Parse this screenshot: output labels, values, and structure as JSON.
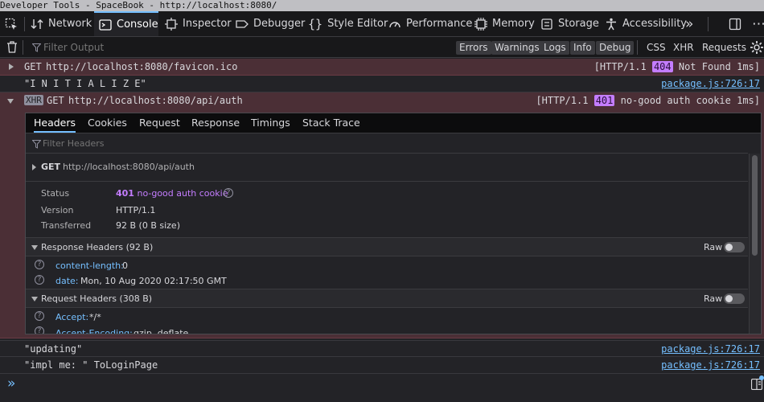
{
  "window": {
    "title": "Developer Tools - SpaceBook - http://localhost:8080/"
  },
  "tabs": [
    {
      "label": "Network",
      "icon": "network-icon"
    },
    {
      "label": "Console",
      "icon": "console-icon",
      "selected": true
    },
    {
      "label": "Inspector",
      "icon": "inspector-icon"
    },
    {
      "label": "Debugger",
      "icon": "debugger-icon"
    },
    {
      "label": "Style Editor",
      "icon": "style-editor-icon"
    },
    {
      "label": "Performance",
      "icon": "performance-icon"
    },
    {
      "label": "Memory",
      "icon": "memory-icon"
    },
    {
      "label": "Storage",
      "icon": "storage-icon"
    },
    {
      "label": "Accessibility",
      "icon": "accessibility-icon"
    }
  ],
  "toolbar": {
    "filter_placeholder": "Filter Output",
    "levels": [
      "Errors",
      "Warnings",
      "Logs",
      "Info",
      "Debug"
    ],
    "net_filters": [
      "CSS",
      "XHR",
      "Requests"
    ]
  },
  "messages": [
    {
      "method": "GET",
      "url": "http://localhost:8080/favicon.ico",
      "status_prefix": "[HTTP/1.1 ",
      "status_code": "404",
      "status_suffix": " Not Found 1ms]"
    },
    {
      "text": "\"I N I T I A L I Z E\"",
      "source": "package.js:726:17"
    },
    {
      "tag": "XHR",
      "method": "GET",
      "url": "http://localhost:8080/api/auth",
      "status_prefix": "[HTTP/1.1 ",
      "status_code": "401",
      "status_suffix": " no-good auth cookie 1ms]"
    },
    {
      "text": "\"updating\"",
      "source": "package.js:726:17"
    },
    {
      "text": "\"impl me: \" ToLoginPage",
      "source": "package.js:726:17"
    }
  ],
  "detail": {
    "tabs": [
      "Headers",
      "Cookies",
      "Request",
      "Response",
      "Timings",
      "Stack Trace"
    ],
    "filter_placeholder": "Filter Headers",
    "request_line": {
      "method": "GET",
      "url": "http://localhost:8080/api/auth"
    },
    "status_label": "Status",
    "status_code": "401",
    "status_text": "no-good auth cookie",
    "version_label": "Version",
    "version": "HTTP/1.1",
    "transferred_label": "Transferred",
    "transferred": "92 B (0 B size)",
    "response_headers_title": "Response Headers (92 B)",
    "response_headers": [
      {
        "name": "content-length:",
        "value": "0"
      },
      {
        "name": "date:",
        "value": "Mon, 10 Aug 2020 02:17:50 GMT"
      }
    ],
    "request_headers_title": "Request Headers (308 B)",
    "request_headers": [
      {
        "name": "Accept:",
        "value": "*/*"
      },
      {
        "name": "Accept-Encoding:",
        "value": "gzip, deflate"
      }
    ],
    "raw_label": "Raw"
  },
  "input": {
    "prompt": "»"
  },
  "colors": {
    "accent": "#75bfff",
    "error_row": "#4b2f36",
    "status_badge": "#c47dff"
  }
}
